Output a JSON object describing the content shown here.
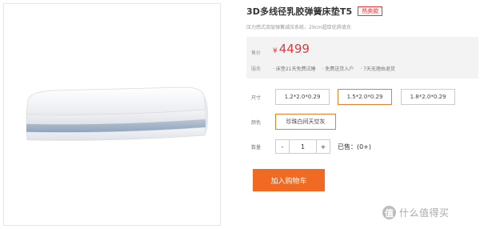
{
  "product": {
    "title": "3D多线径乳胶弹簧床垫T5",
    "badge": "热卖款",
    "subtitle": "压力感式双层弹簧减压系统，29cm超厚优质填充"
  },
  "price": {
    "label": "售价",
    "currency": "¥",
    "value": "4499"
  },
  "service": {
    "label": "服务",
    "items": [
      "· 床垫21天免费试睡",
      "· 免费送货入户",
      "· 7天无理由退货"
    ]
  },
  "size": {
    "label": "尺寸",
    "options": [
      "1.2*2.0*0.29",
      "1.5*2.0*0.29",
      "1.8*2.0*0.29"
    ],
    "selected_index": 1
  },
  "color": {
    "label": "颜色",
    "options": [
      "珍珠白间天空灰"
    ],
    "selected_index": 0
  },
  "quantity": {
    "label": "数量",
    "minus": "-",
    "value": "1",
    "plus": "+",
    "sold_text": "已售：(0+)"
  },
  "cart": {
    "add_label": "加入购物车"
  },
  "watermark": {
    "icon_char": "值",
    "text": "什么值得买"
  },
  "colors": {
    "accent_red": "#e4393c",
    "accent_orange": "#f16a23",
    "selected_border": "#e97d30"
  }
}
